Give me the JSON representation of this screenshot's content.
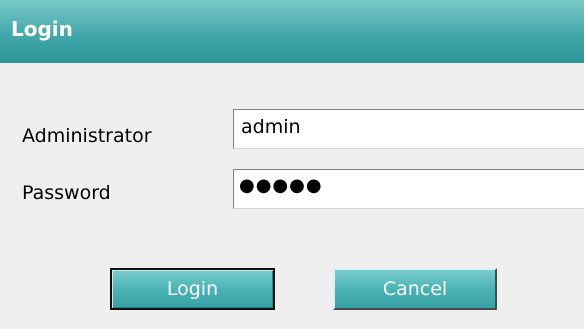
{
  "window": {
    "title": "Login"
  },
  "form": {
    "administrator_label": "Administrator",
    "administrator_value": "admin",
    "password_label": "Password",
    "password_value": "●●●●●"
  },
  "buttons": {
    "login_label": "Login",
    "cancel_label": "Cancel"
  },
  "colors": {
    "title_bar": "#43a8aa",
    "button": "#4ab3b6",
    "background": "#efefef"
  }
}
